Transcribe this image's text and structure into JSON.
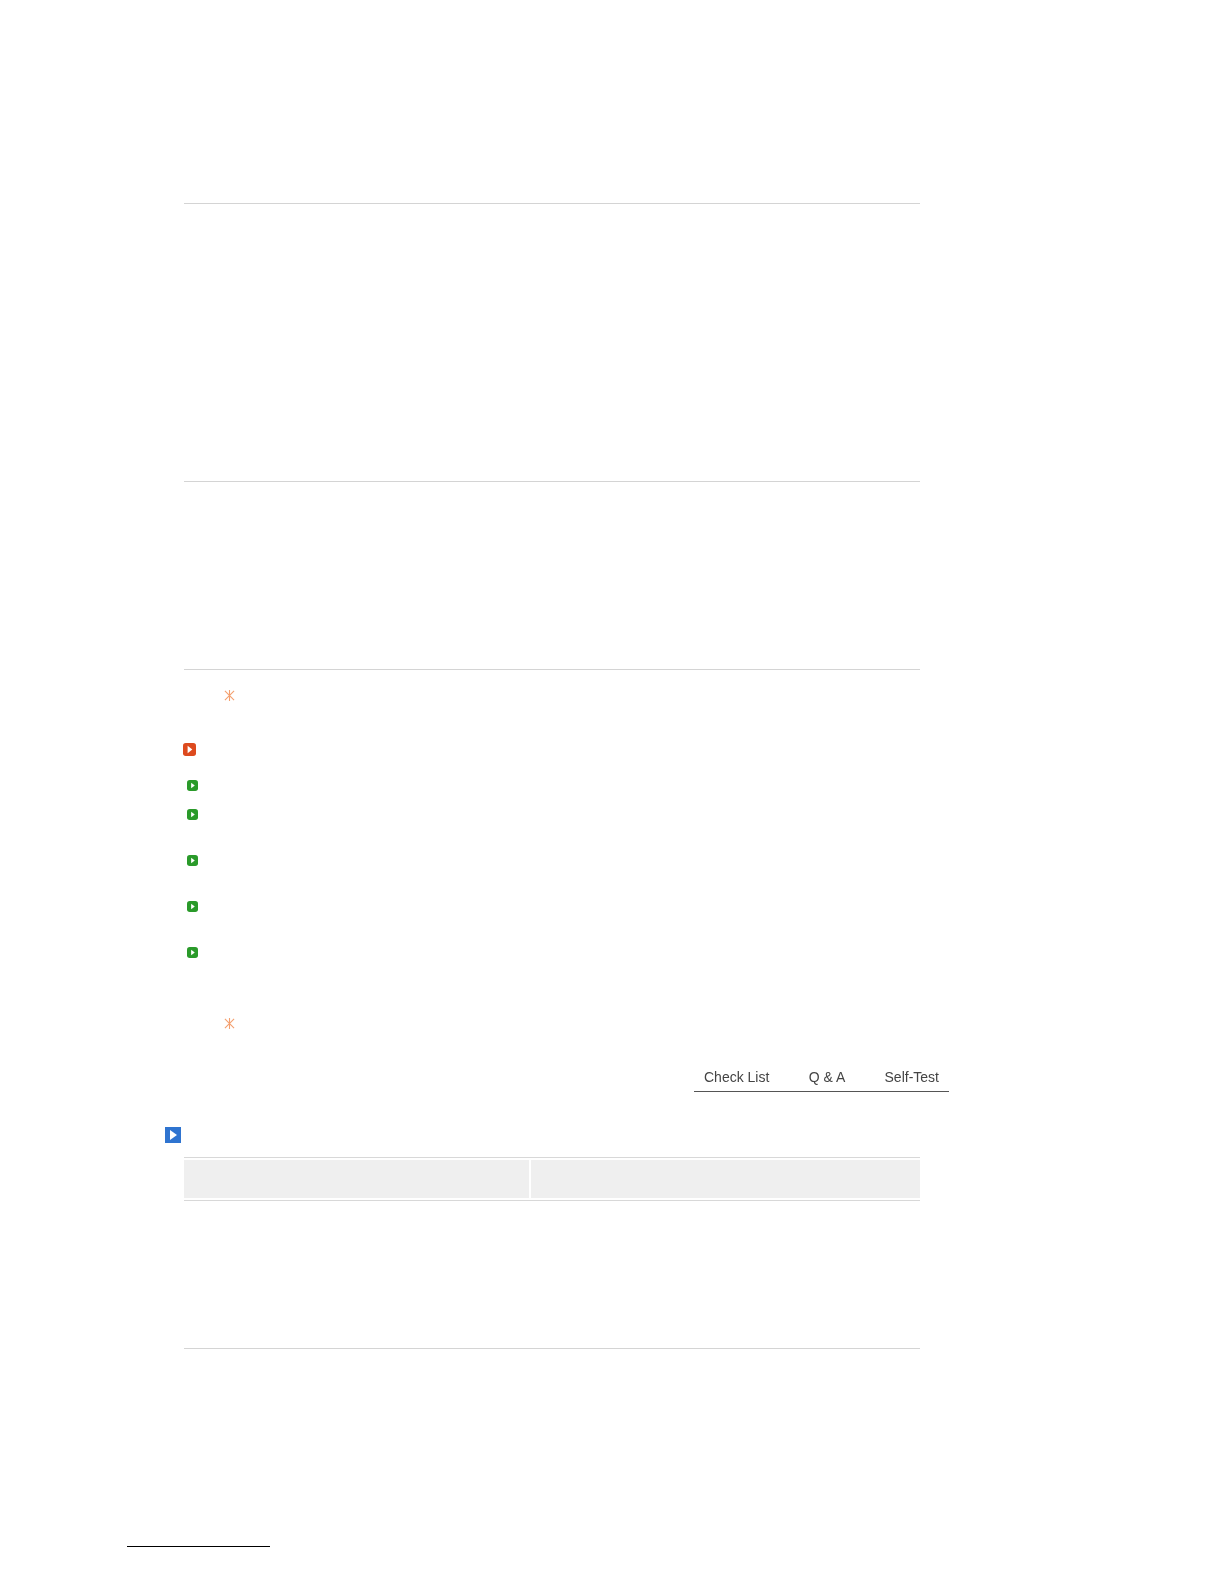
{
  "tabs": [
    {
      "label": "Check List"
    },
    {
      "label": "Q & A"
    },
    {
      "label": "Self-Test"
    }
  ]
}
